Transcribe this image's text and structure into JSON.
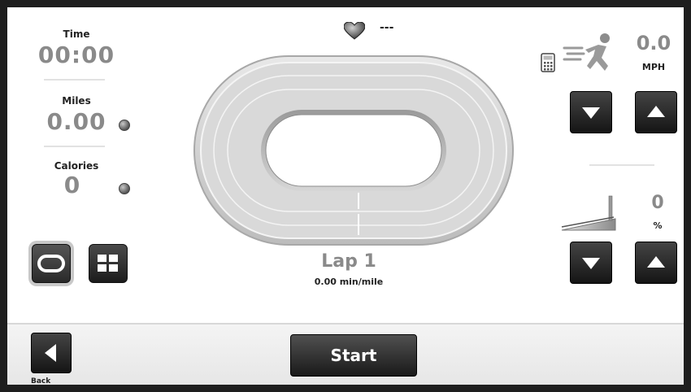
{
  "stats": {
    "time_label": "Time",
    "time_value": "00:00",
    "miles_label": "Miles",
    "miles_value": "0.00",
    "calories_label": "Calories",
    "calories_value": "0"
  },
  "heart_rate": {
    "value": "---",
    "icon": "heart-icon"
  },
  "track": {
    "lap_label": "Lap 1",
    "pace": "0.00 min/mile"
  },
  "speed": {
    "value": "0.0",
    "unit": "MPH",
    "icons": [
      "calculator-icon",
      "runner-icon"
    ]
  },
  "incline": {
    "value": "0",
    "unit": "%",
    "icon": "incline-ramp-icon"
  },
  "views": [
    "track-view",
    "grid-view"
  ],
  "footer": {
    "back_label": "Back",
    "start_label": "Start"
  }
}
